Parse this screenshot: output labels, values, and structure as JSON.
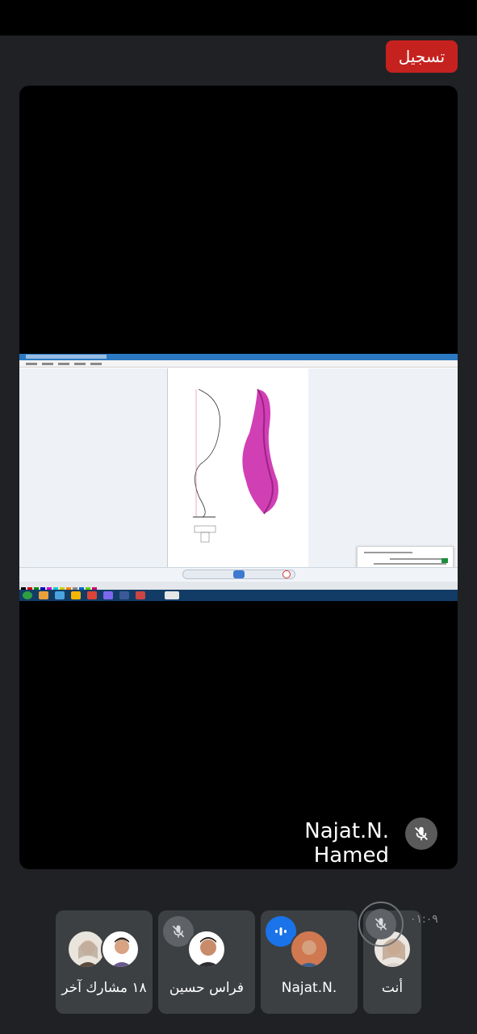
{
  "recording_badge": {
    "label": "تسجيل"
  },
  "main_tile": {
    "speaker_name": "Najat.N. Hamed"
  },
  "participants": [
    {
      "label": "١٨ مشارك آخر"
    },
    {
      "label": "فراس حسين"
    },
    {
      "label": "Najat.N."
    },
    {
      "label": "أنت"
    }
  ],
  "timer": "٠١:٠٩",
  "colors": {
    "recording": "#c5221f",
    "speaking": "#1a73e8",
    "tile": "#3c4043",
    "background": "#202124"
  }
}
